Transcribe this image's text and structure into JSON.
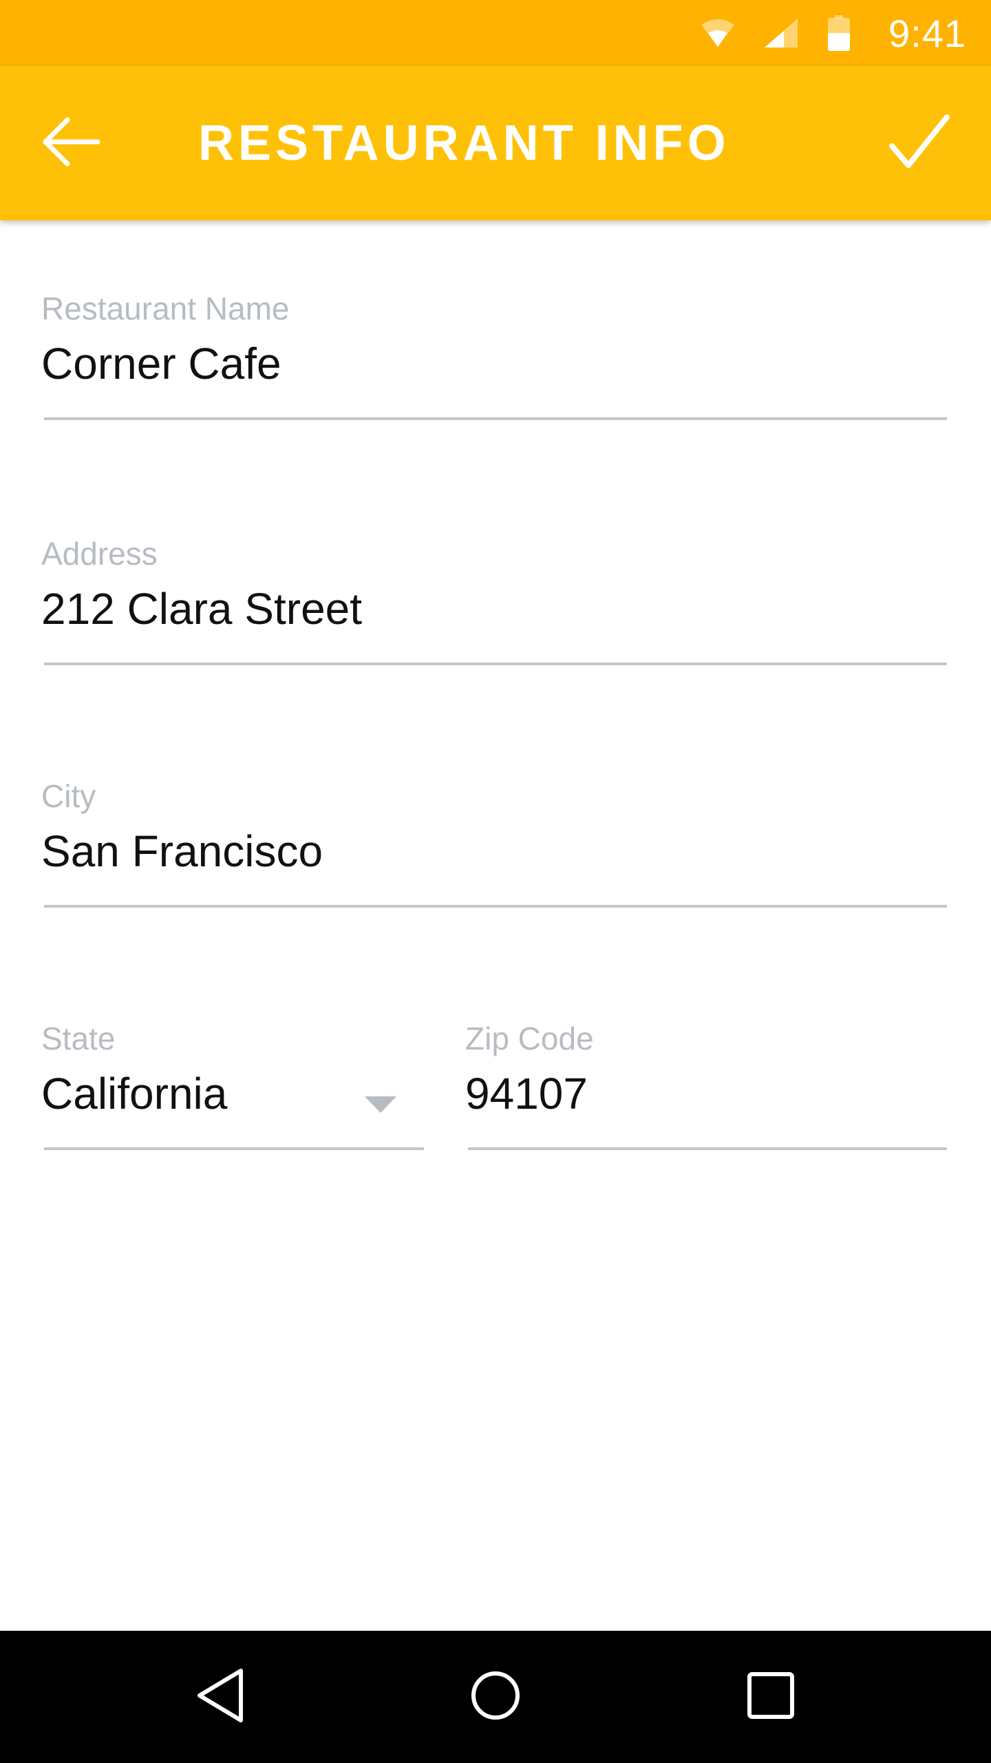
{
  "status_bar": {
    "time": "9:41",
    "icons": [
      "wifi-icon",
      "cell-signal-icon",
      "battery-icon"
    ]
  },
  "app_bar": {
    "title": "RESTAURANT INFO",
    "back_icon": "arrow-back-icon",
    "confirm_icon": "checkmark-icon",
    "color": "#FFC107"
  },
  "form": {
    "restaurant_name": {
      "label": "Restaurant Name",
      "value": "Corner Cafe"
    },
    "address": {
      "label": "Address",
      "value": "212 Clara Street"
    },
    "city": {
      "label": "City",
      "value": "San Francisco"
    },
    "state": {
      "label": "State",
      "value": "California"
    },
    "zip": {
      "label": "Zip Code",
      "value": "94107"
    }
  },
  "nav_bar": {
    "buttons": [
      "back-triangle-icon",
      "home-circle-icon",
      "recents-square-icon"
    ]
  },
  "colors": {
    "status_bar": "#FFB300",
    "app_bar": "#FFC107",
    "label": "#B7BCC2",
    "underline": "#C2C6CA"
  }
}
